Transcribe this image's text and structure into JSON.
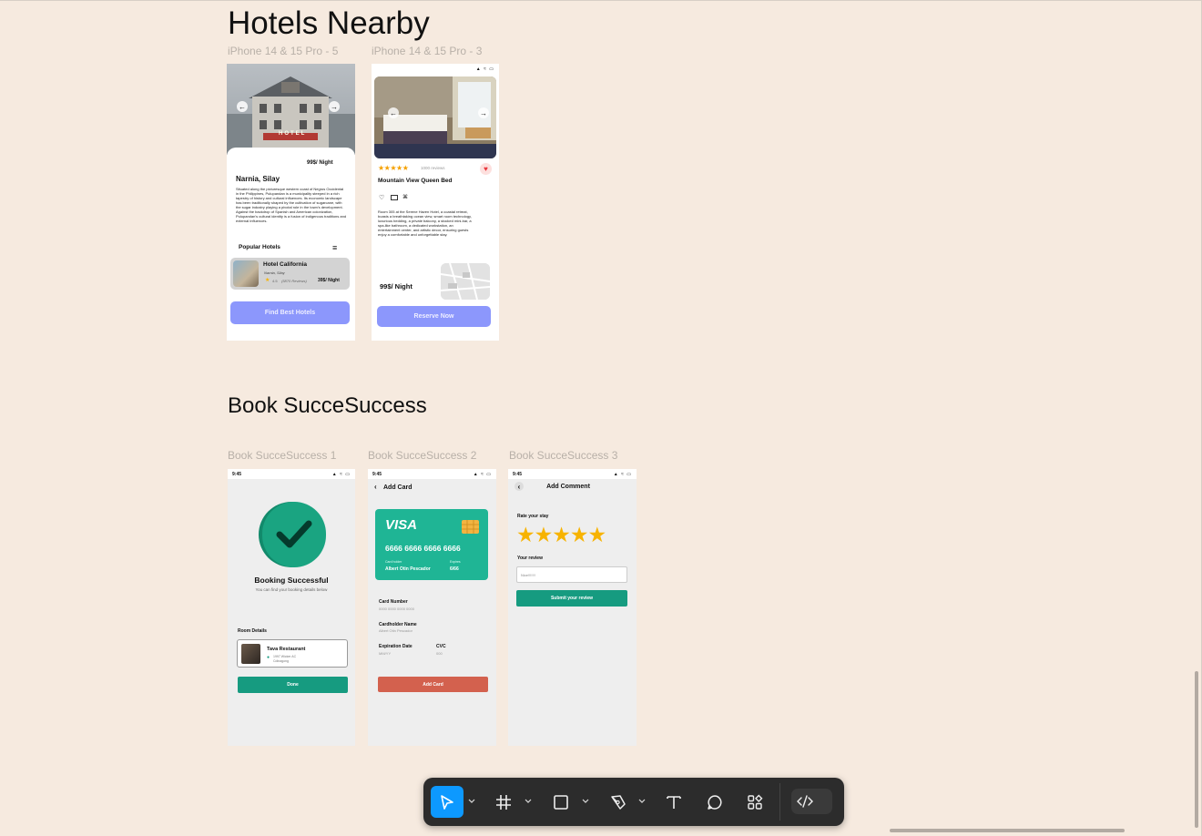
{
  "sections": {
    "hotels_title": "Hotels Nearby",
    "book_title": "Book SucceSuccess"
  },
  "frames": {
    "f1_label": "iPhone 14 & 15 Pro - 5",
    "f2_label": "iPhone 14 & 15 Pro - 3",
    "f3_label": "Book SucceSuccess 1",
    "f4_label": "Book SucceSuccess 2",
    "f5_label": "Book SucceSuccess 3"
  },
  "hotel1": {
    "hero_sign": "HOTEL",
    "price": "99$/ Night",
    "location": "Narnia, Silay",
    "description": "Situated along the picturesque western coast of Negros Occidental in the Philippines, Pulupandan is a municipality steeped in a rich tapestry of history and cultural influences. Its economic landscape has been traditionally shaped by the cultivation of sugarcane, with the sugar industry playing a pivotal role in the town's development. Against the backdrop of Spanish and American colonization, Pulupandan's cultural identity is a fusion of indigenous traditions and external influences.",
    "popular_title": "Popular Hotels",
    "card_name": "Hotel California",
    "card_location": "Narnia, Silay",
    "card_rating": "4.5",
    "card_reviews": "(5870 Reviews)",
    "card_price": "39$/ Night",
    "button": "Find Best Hotels"
  },
  "hotel2": {
    "stars": "★★★★★",
    "reviews": "1000 reviews",
    "room_name": "Mountain View Queen Bed",
    "description": "Room 305 at the Serene Haven Hotel, a coastal retreat, boasts a breathtaking ocean view, smart room technology, luxurious bedding, a private balcony, a stocked mini-bar, a spa-like bathroom, a dedicated workstation, an entertainment center, and artistic decor, ensuring guests enjoy a comfortable and unforgettable stay.",
    "price": "99$/ Night",
    "button": "Reserve Now"
  },
  "success": {
    "time": "9:45",
    "title": "Booking Successful",
    "subtitle": "You can find your booking details below",
    "room_details": "Room Details",
    "place_name": "Tava Restaurant",
    "place_address_line1": "1997 Wicker AC",
    "place_address_line2": "Cdinagong",
    "button": "Done"
  },
  "card": {
    "time": "9:45",
    "header": "Add Card",
    "brand": "VISA",
    "number": "6666 6666 6666 6666",
    "holder_label": "Card holder",
    "holder_name": "Albert Otin Pescador",
    "expiry_label": "Expires",
    "expiry_value": "6/66",
    "card_number_label": "Card Number",
    "card_number_placeholder": "0000 0000 0000 0000",
    "cardholder_label": "Cardholder Name",
    "cardholder_value": "Albert Otin Pescador",
    "exp_date_label": "Expiration Date",
    "exp_date_placeholder": "MM/YY",
    "cvc_label": "CVC",
    "cvc_placeholder": "000",
    "button": "Add Card"
  },
  "comment": {
    "time": "9:45",
    "header": "Add Comment",
    "rate_label": "Rate your stay",
    "stars": "★★★★★",
    "review_label": "Your review",
    "review_value": "Nice!!!!!!!",
    "button": "Submit your review"
  },
  "toolbar": {
    "tools": [
      "move-tool",
      "frame-tool",
      "rectangle-tool",
      "pen-tool",
      "text-tool",
      "comment-tool",
      "actions-tool",
      "dev-mode-toggle"
    ]
  },
  "colors": {
    "canvas": "#f6eadf",
    "purple_button": "#8c97fc",
    "teal": "#169b80",
    "visa_card": "#1fb595",
    "red_button": "#d3614e",
    "star": "#f7b300",
    "tool_active": "#0d99ff"
  }
}
